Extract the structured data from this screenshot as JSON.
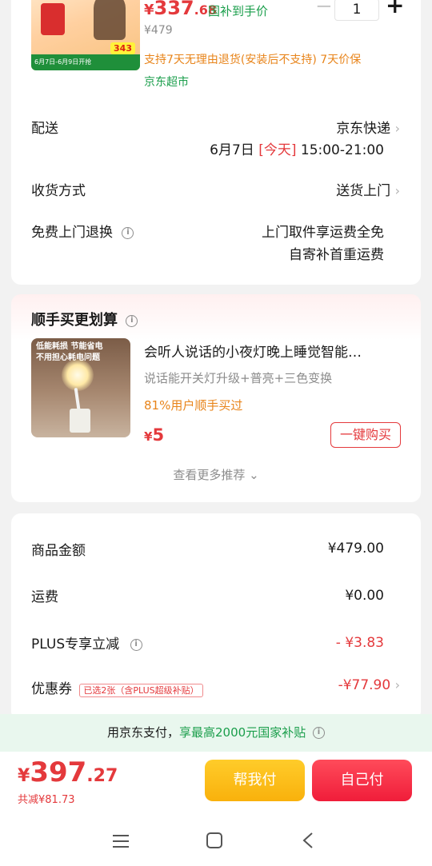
{
  "product": {
    "price_symbol": "¥",
    "price_int": "337",
    "price_dec": ".68",
    "subsidy_label": "国补到手价",
    "original_price": "¥479",
    "quantity": "1",
    "minus": "−",
    "plus": "+",
    "return_policy": "支持7天无理由退货(安装后不支持) 7天价保",
    "store": "京东超市",
    "thumb_banner": "6月7日-6月9日开抢",
    "thumb_price": "343"
  },
  "delivery": {
    "label": "配送",
    "carrier": "京东快递",
    "date": "6月7日",
    "today": "[今天]",
    "time": "15:00-21:00"
  },
  "receive": {
    "label": "收货方式",
    "value": "送货上门"
  },
  "free_return": {
    "label": "免费上门退换",
    "line1": "上门取件享运费全免",
    "line2": "自寄补首重运费"
  },
  "reco": {
    "title": "顺手买更划算",
    "thumb_text_1": "低能耗损 节能省电",
    "thumb_text_2": "不用担心耗电问题",
    "name": "会听人说话的小夜灯晚上睡觉智能…",
    "desc": "说话能开关灯升级+普亮+三色变换",
    "stat": "81%用户顺手买过",
    "price_symbol": "¥",
    "price": "5",
    "buy_label": "一键购买",
    "more_label": "查看更多推荐"
  },
  "summary": {
    "goods_label": "商品金额",
    "goods_value": "¥479.00",
    "shipping_label": "运费",
    "shipping_value": "¥0.00",
    "plus_label": "PLUS专享立减",
    "plus_value": "- ¥3.83",
    "coupon_label": "优惠券",
    "coupon_tag": "已选2张（含PLUS超级补贴）",
    "coupon_value": "-¥77.90"
  },
  "promo": {
    "prefix": "用京东支付，",
    "highlight": "享最高2000元国家补贴"
  },
  "footer": {
    "total_symbol": "¥",
    "total_int": "397",
    "total_dec": ".27",
    "saved": "共减¥81.73",
    "help_pay": "帮我付",
    "self_pay": "自己付"
  },
  "colors": {
    "accent_red": "#e4393c",
    "green": "#1a9e4b",
    "orange": "#e8841a",
    "yellow_btn": "#f9b10c"
  }
}
